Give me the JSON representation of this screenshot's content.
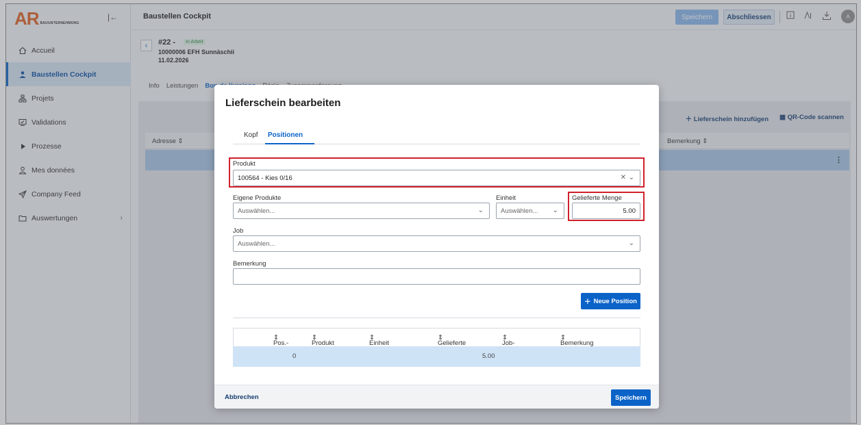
{
  "app": {
    "logo_main": "AR",
    "logo_sub": "BAUUNTERNEHMUNG",
    "page_title": "Baustellen Cockpit"
  },
  "sidebar": {
    "items": [
      {
        "label": "Accueil",
        "icon": "home-icon"
      },
      {
        "label": "Baustellen Cockpit",
        "icon": "person-icon",
        "active": true
      },
      {
        "label": "Projets",
        "icon": "sitemap-icon"
      },
      {
        "label": "Validations",
        "icon": "monitor-check-icon"
      },
      {
        "label": "Prozesse",
        "icon": "process-icon"
      },
      {
        "label": "Mes données",
        "icon": "user-icon"
      },
      {
        "label": "Company Feed",
        "icon": "send-icon"
      },
      {
        "label": "Auswertungen",
        "icon": "folder-icon",
        "has_submenu": true
      }
    ]
  },
  "topbar": {
    "save_label": "Speichern",
    "close_label": "Abschliessen",
    "avatar_initial": "A"
  },
  "header": {
    "number": "#22 -",
    "status": "In Arbeit",
    "project": "10000006 EFH Sunnäschii",
    "date": "11.02.2026",
    "tabs": [
      "Info",
      "Leistungen",
      "Bon de livraison",
      "Régie",
      "Zusammenfassung"
    ],
    "active_tab": "Bon de livraison"
  },
  "content": {
    "add_label": "Lieferschein hinzufügen",
    "qr_label": "QR-Code scannen",
    "col_address": "Adresse",
    "col_remark": "Bemerkung"
  },
  "modal": {
    "title": "Lieferschein bearbeiten",
    "tabs": [
      "Kopf",
      "Positionen"
    ],
    "active_tab": "Positionen",
    "produkt_label": "Produkt",
    "produkt_value": "100564 - Kies 0/16",
    "eigene_label": "Eigene Produkte",
    "eigene_placeholder": "Auswählen...",
    "einheit_label": "Einheit",
    "einheit_placeholder": "Auswählen...",
    "menge_label": "Gelieferte Menge",
    "menge_value": "5.00",
    "job_label": "Job",
    "job_placeholder": "Auswählen...",
    "bemerkung_label": "Bemerkung",
    "bemerkung_value": "",
    "new_position_label": "Neue Position",
    "table": {
      "headers": [
        "Pos.-Nr.",
        "Produkt",
        "Einheit",
        "Gelieferte Menge",
        "Job-Code",
        "Bemerkung"
      ],
      "rows": [
        {
          "pos": "0",
          "produkt": "",
          "einheit": "",
          "menge": "5.00",
          "job": "",
          "bemerkung": ""
        }
      ]
    },
    "cancel_label": "Abbrechen",
    "save_label": "Speichern"
  },
  "colors": {
    "accent": "#0b63c8",
    "logo": "#e0601f",
    "highlight": "#d0202b",
    "status_badge": "#2f8a44"
  }
}
